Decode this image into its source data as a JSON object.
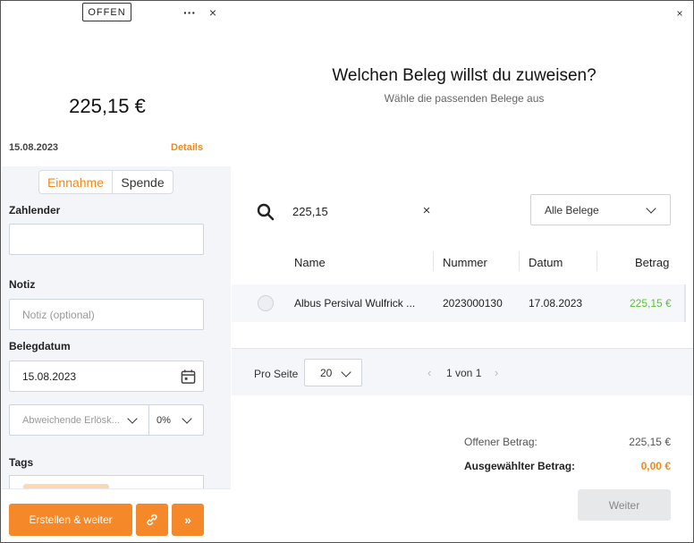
{
  "left": {
    "status": "OFFEN",
    "more_label": "···",
    "close_label": "×",
    "amount": "225,15 €",
    "date": "15.08.2023",
    "details_label": "Details",
    "segment": {
      "option_a": "Einnahme",
      "option_b": "Spende",
      "active": "Einnahme"
    },
    "zahlender": {
      "label": "Zahlender",
      "value": ""
    },
    "notiz": {
      "label": "Notiz",
      "placeholder": "Notiz (optional)"
    },
    "belegdatum": {
      "label": "Belegdatum",
      "value": "15.08.2023"
    },
    "erloes": {
      "placeholder": "Abweichende Erlösk...",
      "tax": "0%"
    },
    "tags": {
      "label": "Tags"
    },
    "buttons": {
      "create": "Erstellen & weiter",
      "link_icon": "link-icon",
      "forward_label": "»"
    }
  },
  "right": {
    "close_label": "×",
    "title": "Welchen Beleg willst du zuweisen?",
    "subtitle": "Wähle die passenden Belege aus",
    "search": {
      "value": "225,15",
      "clear_label": "×"
    },
    "filter": {
      "selected": "Alle Belege"
    },
    "table": {
      "headers": {
        "name": "Name",
        "nummer": "Nummer",
        "datum": "Datum",
        "betrag": "Betrag"
      },
      "rows": [
        {
          "name": "Albus Persival Wulfrick ...",
          "nummer": "2023000130",
          "datum": "17.08.2023",
          "betrag": "225,15 €"
        }
      ]
    },
    "pager": {
      "per_page_label": "Pro Seite",
      "per_page": "20",
      "info": "1 von 1",
      "prev": "‹",
      "next": "›"
    },
    "summary": {
      "offen_label": "Offener Betrag:",
      "offen_value": "225,15 €",
      "ausgewaehlt_label": "Ausgewählter Betrag:",
      "ausgewaehlt_value": "0,00 €"
    },
    "weiter_label": "Weiter"
  },
  "colors": {
    "accent": "#f5892a",
    "accent_text": "#f08a1c",
    "positive": "#5bc236",
    "disabled_bg": "#e7e8ea"
  }
}
